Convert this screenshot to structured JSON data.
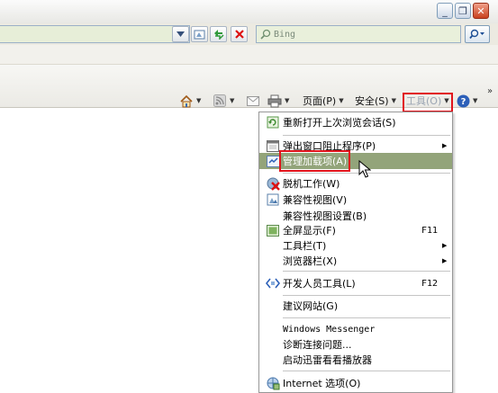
{
  "window": {
    "minimize_glyph": "_",
    "restore_glyph": "❐",
    "close_glyph": "✕"
  },
  "address_bar": {
    "compat_icon": "compatibility-icon",
    "refresh_icon": "refresh-icon",
    "stop_icon": "stop-icon"
  },
  "search": {
    "placeholder": "Bing",
    "search_icon": "search-icon"
  },
  "command_bar": {
    "home_icon": "home-icon",
    "feeds_icon": "feeds-icon",
    "mail_icon": "mail-icon",
    "print_icon": "print-icon",
    "page_label": "页面(P)",
    "safety_label": "安全(S)",
    "tools_label": "工具(O)",
    "help_icon": "help-icon",
    "more_glyph": "»"
  },
  "menu": {
    "items": [
      {
        "label": "重新打开上次浏览会话(S)",
        "shortcut": "",
        "submenu": false,
        "icon": "reopen-session-icon"
      },
      {
        "label": "弹出窗口阻止程序(P)",
        "shortcut": "",
        "submenu": true,
        "icon": "popup-blocker-icon"
      },
      {
        "label": "管理加载项(A)",
        "shortcut": "",
        "submenu": false,
        "icon": "manage-addons-icon",
        "highlighted": true
      },
      {
        "label": "脱机工作(W)",
        "shortcut": "",
        "submenu": false,
        "icon": "offline-icon"
      },
      {
        "label": "兼容性视图(V)",
        "shortcut": "",
        "submenu": false,
        "icon": "compatibility-view-icon"
      },
      {
        "label": "兼容性视图设置(B)",
        "shortcut": "",
        "submenu": false,
        "icon": ""
      },
      {
        "label": "全屏显示(F)",
        "shortcut": "F11",
        "submenu": false,
        "icon": "fullscreen-icon"
      },
      {
        "label": "工具栏(T)",
        "shortcut": "",
        "submenu": true,
        "icon": ""
      },
      {
        "label": "浏览器栏(X)",
        "shortcut": "",
        "submenu": true,
        "icon": ""
      },
      {
        "label": "开发人员工具(L)",
        "shortcut": "F12",
        "submenu": false,
        "icon": "developer-tools-icon"
      },
      {
        "label": "建议网站(G)",
        "shortcut": "",
        "submenu": false,
        "icon": ""
      },
      {
        "label": "Windows Messenger",
        "shortcut": "",
        "submenu": false,
        "icon": ""
      },
      {
        "label": "诊断连接问题...",
        "shortcut": "",
        "submenu": false,
        "icon": ""
      },
      {
        "label": "启动迅雷看看播放器",
        "shortcut": "",
        "submenu": false,
        "icon": ""
      },
      {
        "label": "Internet 选项(O)",
        "shortcut": "",
        "submenu": false,
        "icon": "internet-options-icon"
      }
    ]
  },
  "colors": {
    "highlight_bg": "#93a47a",
    "callout_red": "#e1141c"
  }
}
